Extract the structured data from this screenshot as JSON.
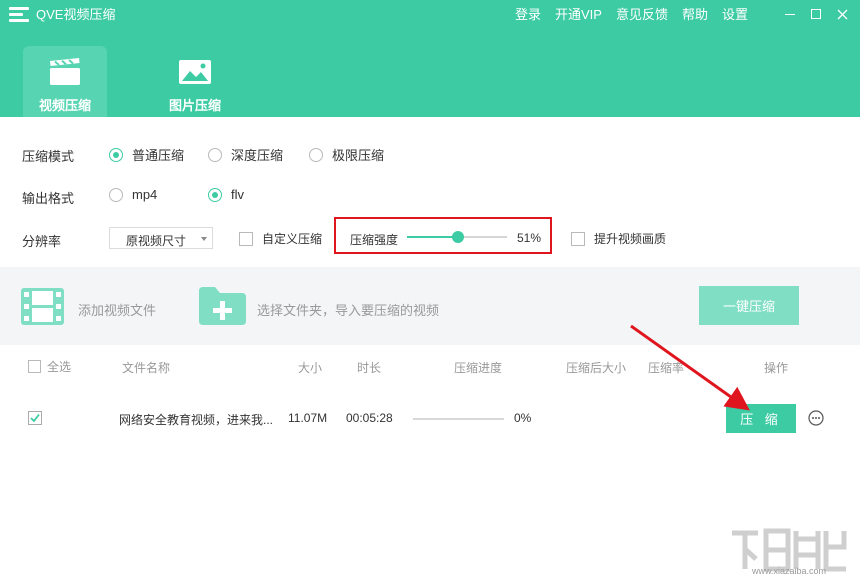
{
  "app": {
    "title": "QVE视频压缩"
  },
  "top_nav": [
    "登录",
    "开通VIP",
    "意见反馈",
    "帮助",
    "设置"
  ],
  "main_tabs": [
    {
      "label": "视频压缩",
      "active": true,
      "icon": "clapperboard-icon"
    },
    {
      "label": "图片压缩",
      "active": false,
      "icon": "picture-icon"
    }
  ],
  "settings": {
    "mode_label": "压缩模式",
    "modes": [
      {
        "label": "普通压缩",
        "checked": true
      },
      {
        "label": "深度压缩",
        "checked": false
      },
      {
        "label": "极限压缩",
        "checked": false
      }
    ],
    "format_label": "输出格式",
    "formats": [
      {
        "label": "mp4",
        "checked": false
      },
      {
        "label": "flv",
        "checked": true
      }
    ],
    "resolution_label": "分辨率",
    "resolution_value": "原视频尺寸",
    "custom_compress_label": "自定义压缩",
    "custom_compress_checked": false,
    "strength_label": "压缩强度",
    "strength_value": "51%",
    "strength_fraction": 0.51,
    "enhance_quality_label": "提升视频画质",
    "enhance_quality_checked": false
  },
  "add_panel": {
    "add_video_label": "添加视频文件",
    "add_folder_label": "选择文件夹，导入要压缩的视频",
    "compress_all_label": "一键压缩"
  },
  "table": {
    "select_all_label": "全选",
    "headers": {
      "name": "文件名称",
      "size": "大小",
      "duration": "时长",
      "progress": "压缩进度",
      "compressed_size": "压缩后大小",
      "ratio": "压缩率",
      "actions": "操作"
    },
    "rows": [
      {
        "checked": true,
        "name": "网络安全教育视频，进来我...",
        "size": "11.07M",
        "duration": "00:05:28",
        "progress_fraction": 0,
        "progress_text": "0%",
        "action_label": "压 缩"
      }
    ]
  },
  "colors": {
    "accent": "#3dcba3",
    "annotation_red": "#e0161e"
  },
  "watermark": {
    "url": "www.xiazaiba.com"
  }
}
